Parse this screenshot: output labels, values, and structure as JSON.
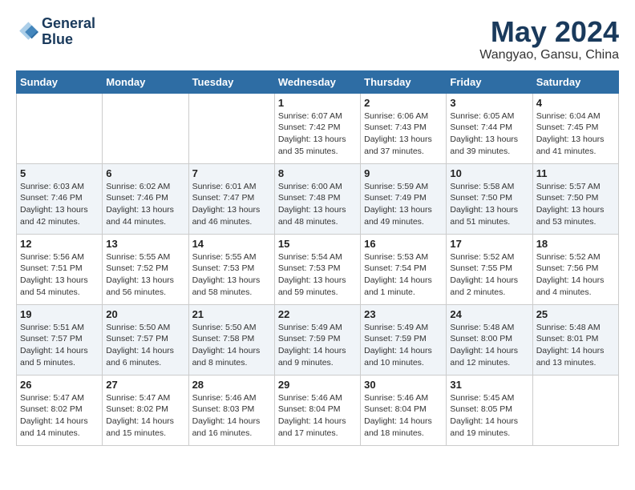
{
  "header": {
    "logo_line1": "General",
    "logo_line2": "Blue",
    "month_year": "May 2024",
    "location": "Wangyao, Gansu, China"
  },
  "days_of_week": [
    "Sunday",
    "Monday",
    "Tuesday",
    "Wednesday",
    "Thursday",
    "Friday",
    "Saturday"
  ],
  "weeks": [
    [
      {
        "day": "",
        "info": ""
      },
      {
        "day": "",
        "info": ""
      },
      {
        "day": "",
        "info": ""
      },
      {
        "day": "1",
        "info": "Sunrise: 6:07 AM\nSunset: 7:42 PM\nDaylight: 13 hours\nand 35 minutes."
      },
      {
        "day": "2",
        "info": "Sunrise: 6:06 AM\nSunset: 7:43 PM\nDaylight: 13 hours\nand 37 minutes."
      },
      {
        "day": "3",
        "info": "Sunrise: 6:05 AM\nSunset: 7:44 PM\nDaylight: 13 hours\nand 39 minutes."
      },
      {
        "day": "4",
        "info": "Sunrise: 6:04 AM\nSunset: 7:45 PM\nDaylight: 13 hours\nand 41 minutes."
      }
    ],
    [
      {
        "day": "5",
        "info": "Sunrise: 6:03 AM\nSunset: 7:46 PM\nDaylight: 13 hours\nand 42 minutes."
      },
      {
        "day": "6",
        "info": "Sunrise: 6:02 AM\nSunset: 7:46 PM\nDaylight: 13 hours\nand 44 minutes."
      },
      {
        "day": "7",
        "info": "Sunrise: 6:01 AM\nSunset: 7:47 PM\nDaylight: 13 hours\nand 46 minutes."
      },
      {
        "day": "8",
        "info": "Sunrise: 6:00 AM\nSunset: 7:48 PM\nDaylight: 13 hours\nand 48 minutes."
      },
      {
        "day": "9",
        "info": "Sunrise: 5:59 AM\nSunset: 7:49 PM\nDaylight: 13 hours\nand 49 minutes."
      },
      {
        "day": "10",
        "info": "Sunrise: 5:58 AM\nSunset: 7:50 PM\nDaylight: 13 hours\nand 51 minutes."
      },
      {
        "day": "11",
        "info": "Sunrise: 5:57 AM\nSunset: 7:50 PM\nDaylight: 13 hours\nand 53 minutes."
      }
    ],
    [
      {
        "day": "12",
        "info": "Sunrise: 5:56 AM\nSunset: 7:51 PM\nDaylight: 13 hours\nand 54 minutes."
      },
      {
        "day": "13",
        "info": "Sunrise: 5:55 AM\nSunset: 7:52 PM\nDaylight: 13 hours\nand 56 minutes."
      },
      {
        "day": "14",
        "info": "Sunrise: 5:55 AM\nSunset: 7:53 PM\nDaylight: 13 hours\nand 58 minutes."
      },
      {
        "day": "15",
        "info": "Sunrise: 5:54 AM\nSunset: 7:53 PM\nDaylight: 13 hours\nand 59 minutes."
      },
      {
        "day": "16",
        "info": "Sunrise: 5:53 AM\nSunset: 7:54 PM\nDaylight: 14 hours\nand 1 minute."
      },
      {
        "day": "17",
        "info": "Sunrise: 5:52 AM\nSunset: 7:55 PM\nDaylight: 14 hours\nand 2 minutes."
      },
      {
        "day": "18",
        "info": "Sunrise: 5:52 AM\nSunset: 7:56 PM\nDaylight: 14 hours\nand 4 minutes."
      }
    ],
    [
      {
        "day": "19",
        "info": "Sunrise: 5:51 AM\nSunset: 7:57 PM\nDaylight: 14 hours\nand 5 minutes."
      },
      {
        "day": "20",
        "info": "Sunrise: 5:50 AM\nSunset: 7:57 PM\nDaylight: 14 hours\nand 6 minutes."
      },
      {
        "day": "21",
        "info": "Sunrise: 5:50 AM\nSunset: 7:58 PM\nDaylight: 14 hours\nand 8 minutes."
      },
      {
        "day": "22",
        "info": "Sunrise: 5:49 AM\nSunset: 7:59 PM\nDaylight: 14 hours\nand 9 minutes."
      },
      {
        "day": "23",
        "info": "Sunrise: 5:49 AM\nSunset: 7:59 PM\nDaylight: 14 hours\nand 10 minutes."
      },
      {
        "day": "24",
        "info": "Sunrise: 5:48 AM\nSunset: 8:00 PM\nDaylight: 14 hours\nand 12 minutes."
      },
      {
        "day": "25",
        "info": "Sunrise: 5:48 AM\nSunset: 8:01 PM\nDaylight: 14 hours\nand 13 minutes."
      }
    ],
    [
      {
        "day": "26",
        "info": "Sunrise: 5:47 AM\nSunset: 8:02 PM\nDaylight: 14 hours\nand 14 minutes."
      },
      {
        "day": "27",
        "info": "Sunrise: 5:47 AM\nSunset: 8:02 PM\nDaylight: 14 hours\nand 15 minutes."
      },
      {
        "day": "28",
        "info": "Sunrise: 5:46 AM\nSunset: 8:03 PM\nDaylight: 14 hours\nand 16 minutes."
      },
      {
        "day": "29",
        "info": "Sunrise: 5:46 AM\nSunset: 8:04 PM\nDaylight: 14 hours\nand 17 minutes."
      },
      {
        "day": "30",
        "info": "Sunrise: 5:46 AM\nSunset: 8:04 PM\nDaylight: 14 hours\nand 18 minutes."
      },
      {
        "day": "31",
        "info": "Sunrise: 5:45 AM\nSunset: 8:05 PM\nDaylight: 14 hours\nand 19 minutes."
      },
      {
        "day": "",
        "info": ""
      }
    ]
  ]
}
